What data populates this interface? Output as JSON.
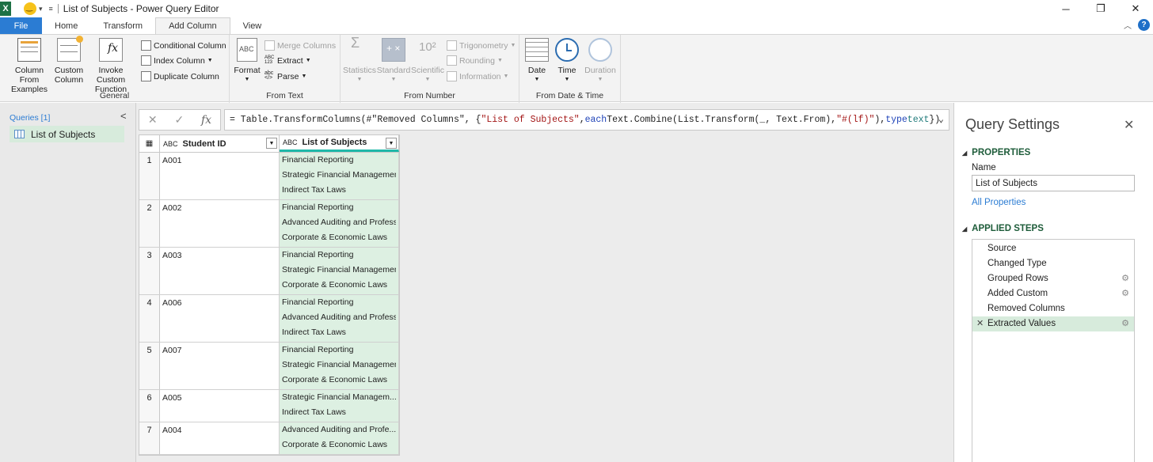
{
  "window": {
    "title": "List of Subjects - Power Query Editor",
    "app_logo": "X",
    "controls": [
      "─",
      "❐",
      "✕"
    ]
  },
  "ribbon_tabs": [
    "File",
    "Home",
    "Transform",
    "Add Column",
    "View"
  ],
  "ribbon": {
    "general": {
      "label": "General",
      "column_from_examples": [
        "Column From",
        "Examples"
      ],
      "custom_column": [
        "Custom",
        "Column"
      ],
      "invoke_custom_function": [
        "Invoke Custom",
        "Function"
      ],
      "conditional_column": "Conditional Column",
      "index_column": "Index Column",
      "duplicate_column": "Duplicate Column"
    },
    "from_text": {
      "label": "From Text",
      "format": "Format",
      "merge_columns": "Merge Columns",
      "extract": "Extract",
      "parse": "Parse"
    },
    "from_number": {
      "label": "From Number",
      "statistics": "Statistics",
      "standard": "Standard",
      "scientific": "Scientific",
      "trigonometry": "Trigonometry",
      "rounding": "Rounding",
      "information": "Information"
    },
    "from_date_time": {
      "label": "From Date & Time",
      "date": "Date",
      "time": "Time",
      "duration": "Duration"
    }
  },
  "queries": {
    "header": "Queries [1]",
    "items": [
      "List of Subjects"
    ]
  },
  "formula": {
    "p1": "= Table.TransformColumns(#\"Removed Columns\", {",
    "p2": "\"List of Subjects\"",
    "p3": ", ",
    "p4": "each",
    "p5": " Text.Combine(List.Transform(_, Text.From), ",
    "p6": "\"#(lf)\"",
    "p7": "), ",
    "p8": "type",
    "p9": " ",
    "p10": "text",
    "p11": "})"
  },
  "grid": {
    "columns": [
      {
        "type": "ABC",
        "name": "Student ID"
      },
      {
        "type": "ABC",
        "name": "List of Subjects"
      }
    ],
    "rows": [
      {
        "n": "1",
        "id": "A001",
        "subjects": [
          "Financial Reporting",
          "Strategic Financial Management",
          "Indirect Tax Laws"
        ]
      },
      {
        "n": "2",
        "id": "A002",
        "subjects": [
          "Financial Reporting",
          "Advanced Auditing and Professional Ethics",
          "Corporate & Economic Laws"
        ]
      },
      {
        "n": "3",
        "id": "A003",
        "subjects": [
          "Financial Reporting",
          "Strategic Financial Management",
          "Corporate & Economic Laws"
        ]
      },
      {
        "n": "4",
        "id": "A006",
        "subjects": [
          "Financial Reporting",
          "Advanced Auditing and Professional Ethics",
          "Indirect Tax Laws"
        ]
      },
      {
        "n": "5",
        "id": "A007",
        "subjects": [
          "Financial Reporting",
          "Strategic Financial Management",
          "Corporate & Economic Laws"
        ]
      },
      {
        "n": "6",
        "id": "A005",
        "subjects": [
          "Strategic Financial Managem...",
          "Indirect Tax Laws"
        ]
      },
      {
        "n": "7",
        "id": "A004",
        "subjects": [
          "Advanced Auditing and Profe...",
          "Corporate & Economic Laws"
        ]
      }
    ]
  },
  "settings": {
    "title": "Query Settings",
    "properties_header": "PROPERTIES",
    "name_label": "Name",
    "name_value": "List of Subjects",
    "all_properties": "All Properties",
    "applied_steps_header": "APPLIED STEPS",
    "steps": [
      {
        "name": "Source",
        "gear": false
      },
      {
        "name": "Changed Type",
        "gear": false
      },
      {
        "name": "Grouped Rows",
        "gear": true
      },
      {
        "name": "Added Custom",
        "gear": true
      },
      {
        "name": "Removed Columns",
        "gear": false
      },
      {
        "name": "Extracted Values",
        "gear": true,
        "selected": true
      }
    ]
  },
  "colors": {
    "file_tab": "#2b7cd3",
    "selected_bg": "#d7ebdc",
    "column_highlight": "#ddf0e2",
    "section_header": "#1e5c3a"
  }
}
